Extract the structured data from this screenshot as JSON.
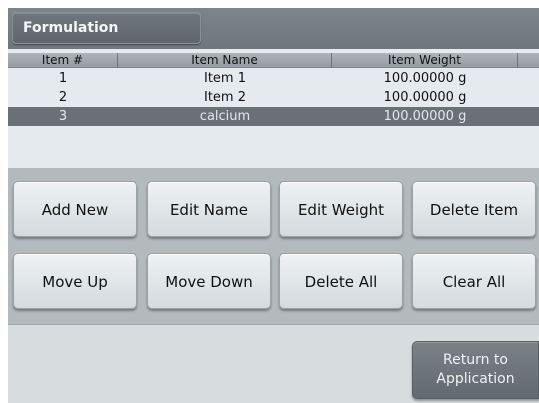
{
  "header": {
    "title": "Formulation"
  },
  "table": {
    "columns": [
      "Item  #",
      "Item Name",
      "Item Weight"
    ],
    "rows": [
      {
        "num": "1",
        "name": "Item 1",
        "weight": "100.00000 g",
        "selected": false
      },
      {
        "num": "2",
        "name": "Item 2",
        "weight": "100.00000 g",
        "selected": false
      },
      {
        "num": "3",
        "name": "calcium",
        "weight": "100.00000 g",
        "selected": true
      }
    ]
  },
  "buttons": {
    "add_new": "Add New",
    "edit_name": "Edit Name",
    "edit_weight": "Edit Weight",
    "delete_item": "Delete Item",
    "move_up": "Move Up",
    "move_down": "Move Down",
    "delete_all": "Delete All",
    "clear_all": "Clear All"
  },
  "footer": {
    "return_line1": "Return to",
    "return_line2": "Application"
  },
  "colors": {
    "selected_row": "#6a7176",
    "title_bar": "#757d82",
    "button_face": "#e2e7ea"
  }
}
